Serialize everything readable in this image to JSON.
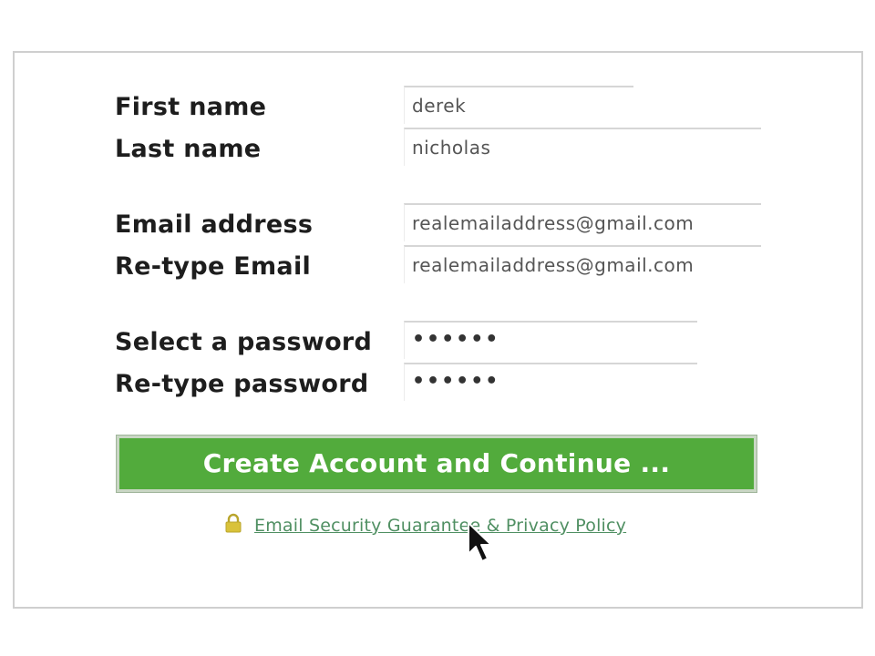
{
  "form": {
    "first_name": {
      "label": "First name",
      "value": "derek"
    },
    "last_name": {
      "label": "Last name",
      "value": "nicholas"
    },
    "email": {
      "label": "Email address",
      "value": "realemailaddress@gmail.com"
    },
    "email_confirm": {
      "label": "Re-type Email",
      "value": "realemailaddress@gmail.com"
    },
    "password": {
      "label": "Select a password",
      "value": "••••••"
    },
    "password_confirm": {
      "label": "Re-type password",
      "value": "••••••"
    },
    "submit_label": "Create Account and Continue ...",
    "privacy_link": "Email Security Guarantee & Privacy Policy"
  },
  "colors": {
    "button_green": "#52ab3c",
    "link_green": "#4f8f62",
    "lock_yellow": "#d9c23a"
  },
  "icons": {
    "lock": "lock-icon",
    "cursor": "mouse-pointer-icon"
  }
}
